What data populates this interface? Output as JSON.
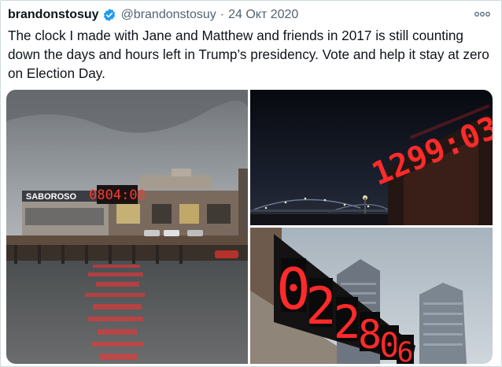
{
  "tweet": {
    "display_name": "brandonstosuy",
    "verified": true,
    "handle": "@brandonstosuy",
    "separator": "·",
    "date": "24 Окт 2020",
    "more_icon": "more-horizontal-icon",
    "text": "The clock I made with Jane and Matthew and friends in 2017 is still counting down the days and hours left in Trump’s presidency. Vote and help it stay at zero on Election Day."
  },
  "media": {
    "photo1": {
      "sign_text": "SABOROSO",
      "clock_text": "0804:08"
    },
    "photo2": {
      "clock_text": "1299:03"
    },
    "photo3": {
      "digits": [
        "0",
        "2",
        "2",
        "8",
        "0",
        "6"
      ]
    }
  },
  "colors": {
    "text": "#0f1419",
    "secondary": "#536471",
    "verified": "#1d9bf0",
    "clock_red": "#ff2a2a"
  }
}
